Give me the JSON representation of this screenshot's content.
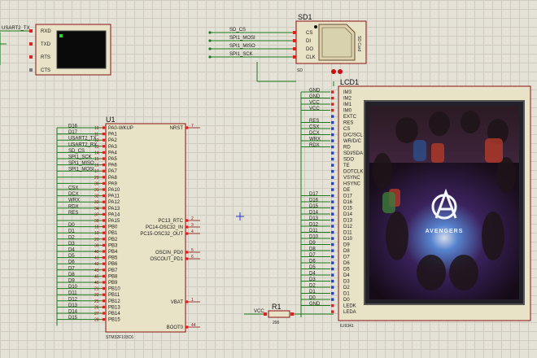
{
  "terminal": {
    "net_label": "USART2_TX",
    "pins": [
      "RXD",
      "TXD",
      "RTS",
      "CTS"
    ]
  },
  "sd1": {
    "ref": "SD1",
    "part": "SD",
    "card_label": "SD Card",
    "pins": [
      "CS",
      "DI",
      "DO",
      "CLK"
    ],
    "nets": [
      "SD_CS",
      "SPI1_MOSI",
      "SPI1_MISO",
      "SPI1_SCK"
    ]
  },
  "u1": {
    "ref": "U1",
    "part": "STM32F103C6",
    "left_pins": [
      {
        "name": "PA0-WKUP",
        "num": "10",
        "net": "D16"
      },
      {
        "name": "PA1",
        "num": "11",
        "net": "D17"
      },
      {
        "name": "PA2",
        "num": "12",
        "net": "USART2_TX"
      },
      {
        "name": "PA3",
        "num": "13",
        "net": "USART2_RX"
      },
      {
        "name": "PA4",
        "num": "14",
        "net": "SD_CS"
      },
      {
        "name": "PA5",
        "num": "15",
        "net": "SPI1_SCK"
      },
      {
        "name": "PA6",
        "num": "16",
        "net": "SPI1_MISO"
      },
      {
        "name": "PA7",
        "num": "17",
        "net": "SPI1_MOSI"
      },
      {
        "name": "PA8",
        "num": "29",
        "net": ""
      },
      {
        "name": "PA9",
        "num": "30",
        "net": ""
      },
      {
        "name": "PA10",
        "num": "31",
        "net": "CSX"
      },
      {
        "name": "PA11",
        "num": "32",
        "net": "DCX"
      },
      {
        "name": "PA12",
        "num": "33",
        "net": "WRX"
      },
      {
        "name": "PA13",
        "num": "34",
        "net": "RDX"
      },
      {
        "name": "PA14",
        "num": "37",
        "net": "RES"
      },
      {
        "name": "PA15",
        "num": "38",
        "net": ""
      },
      {
        "name": "PB0",
        "num": "18",
        "net": "D0"
      },
      {
        "name": "PB1",
        "num": "19",
        "net": "D1"
      },
      {
        "name": "PB2",
        "num": "20",
        "net": "D2"
      },
      {
        "name": "PB3",
        "num": "39",
        "net": "D3"
      },
      {
        "name": "PB4",
        "num": "40",
        "net": "D4"
      },
      {
        "name": "PB5",
        "num": "41",
        "net": "D5"
      },
      {
        "name": "PB6",
        "num": "42",
        "net": "D6"
      },
      {
        "name": "PB7",
        "num": "43",
        "net": "D7"
      },
      {
        "name": "PB8",
        "num": "45",
        "net": "D8"
      },
      {
        "name": "PB9",
        "num": "46",
        "net": "D9"
      },
      {
        "name": "PB10",
        "num": "21",
        "net": "D10"
      },
      {
        "name": "PB11",
        "num": "22",
        "net": "D11"
      },
      {
        "name": "PB12",
        "num": "25",
        "net": "D12"
      },
      {
        "name": "PB13",
        "num": "26",
        "net": "D13"
      },
      {
        "name": "PB14",
        "num": "27",
        "net": "D14"
      },
      {
        "name": "PB15",
        "num": "28",
        "net": "D15"
      }
    ],
    "right_pins": [
      {
        "name": "NRST",
        "num": "7"
      },
      {
        "name": "PC13_RTC",
        "num": "2"
      },
      {
        "name": "PC14-OSC32_IN",
        "num": "3"
      },
      {
        "name": "PC15-OSC32_OUT",
        "num": "4"
      },
      {
        "name": "OSCIN_PD0",
        "num": "5"
      },
      {
        "name": "OSCOUT_PD1",
        "num": "6"
      },
      {
        "name": "VBAT",
        "num": "1"
      },
      {
        "name": "BOOT0",
        "num": "44"
      }
    ]
  },
  "lcd1": {
    "ref": "LCD1",
    "part": "ILI9341",
    "pins": [
      "IM3",
      "IM2",
      "IM1",
      "IM0",
      "EXTC",
      "RES",
      "CS",
      "D/C/SCL",
      "WR/D/C",
      "RD",
      "SDI/SDA",
      "SDO",
      "TE",
      "DOTCLK",
      "VSYNC",
      "HSYNC",
      "DE",
      "D17",
      "D16",
      "D15",
      "D14",
      "D13",
      "D12",
      "D11",
      "D10",
      "D9",
      "D8",
      "D7",
      "D6",
      "D5",
      "D4",
      "D3",
      "D2",
      "D1",
      "D0",
      "LEDK",
      "LEDA"
    ],
    "nets": [
      "GND",
      "GND",
      "VCC",
      "VCC",
      "",
      "RES",
      "CSX",
      "DCX",
      "WRX",
      "RDX",
      "",
      "",
      "",
      "",
      "",
      "",
      "",
      "D17",
      "D16",
      "D15",
      "D14",
      "D13",
      "D12",
      "D11",
      "D10",
      "D9",
      "D8",
      "D7",
      "D6",
      "D5",
      "D4",
      "D3",
      "D2",
      "D1",
      "D0",
      "GND",
      ""
    ],
    "screen_title": "AVENGERS"
  },
  "r1": {
    "ref": "R1",
    "value": "200",
    "net": "VCC"
  },
  "colors": {
    "wire": "#1a7a1a",
    "body_fill": "#e8e3c6",
    "body_stroke": "#8a1010",
    "pin_red": "#e02020",
    "pin_blue": "#2040e0",
    "pin_gray": "#7a7a7a",
    "grid": "#cfccbf"
  }
}
